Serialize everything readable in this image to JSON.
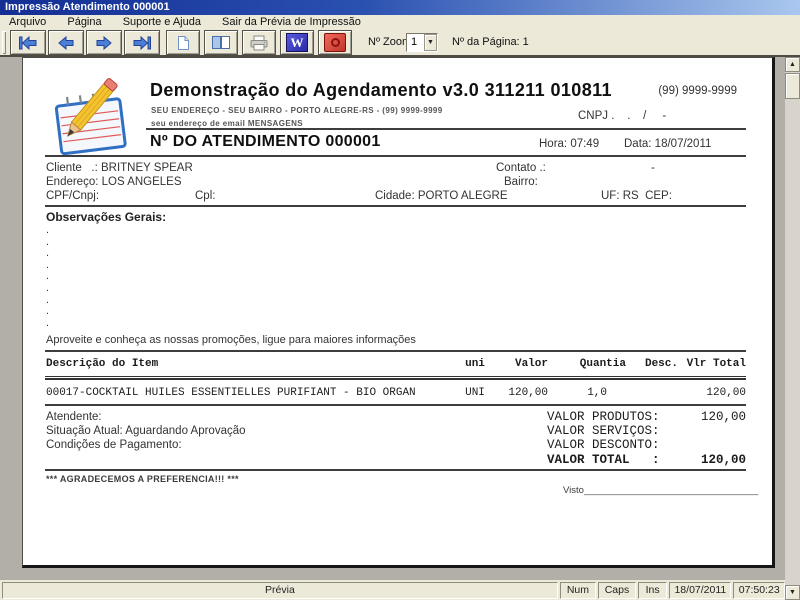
{
  "window": {
    "title": "Impressão Atendimento 000001"
  },
  "menu": {
    "items": [
      "Arquivo",
      "Página",
      "Suporte e Ajuda",
      "Sair da Prévia de Impressão"
    ]
  },
  "toolbar": {
    "zoom_label": "Nº Zoom",
    "zoom_value": "1",
    "page_indicator": "Nº da Página: 1"
  },
  "icons": {
    "word_glyph": "W",
    "up_arrow": "▲",
    "down_arrow": "▼",
    "combo_arrow": "▼"
  },
  "document": {
    "company": {
      "title": "Demonstração do Agendamento v3.0 311211 010811",
      "address": "SEU ENDEREÇO - SEU BAIRRO - PORTO ALEGRE-RS - (99) 9999-9999",
      "email_line": "seu endereço de email  MENSAGENS",
      "phone": "(99) 9999-9999",
      "cnpj": "CNPJ .    .    /     -"
    },
    "order": {
      "number_title": "Nº DO ATENDIMENTO 000001",
      "time": "Hora: 07:49",
      "date": "Data: 18/07/2011"
    },
    "client": {
      "cliente_label": "Cliente   .: ",
      "cliente_value": "BRITNEY SPEAR",
      "contato_label": "Contato .:",
      "contato_value": "-",
      "endereco_label": "Endereço: ",
      "endereco_value": "LOS ANGELES",
      "bairro_label": "Bairro:",
      "cpf_label": "CPF/Cnpj:",
      "cpl_label": "Cpl:",
      "cidade_label": "Cidade: ",
      "cidade_value": "PORTO ALEGRE",
      "uf_cep": "UF: RS  CEP:"
    },
    "observations": {
      "title": "Observações Gerais:",
      "dots": [
        ".",
        ".",
        ".",
        ".",
        ".",
        ".",
        ".",
        ".",
        "."
      ],
      "promo": "Aproveite e conheça as nossas promoções, ligue para maiores informações"
    },
    "items_table": {
      "headers": [
        "Descrição do Item",
        "uni",
        "Valor",
        "Quantia",
        "Desc.",
        "Vlr Total"
      ],
      "rows": [
        {
          "descricao": "00017-COCKTAIL HUILES ESSENTIELLES PURIFIANT - BIO ORGAN",
          "uni": "UNI",
          "valor": "120,00",
          "quantia": "1,0",
          "desc": "",
          "vlr_total": "120,00"
        }
      ]
    },
    "footer": {
      "atendente_label": "Atendente:",
      "situacao_label": "Situação Atual: ",
      "situacao_value": "Aguardando Aprovação",
      "condicoes_label": "Condições de Pagamento:",
      "valor_produtos_label": "VALOR PRODUTOS:",
      "valor_produtos": "120,00",
      "valor_servicos_label": "VALOR SERVIÇOS:",
      "valor_servicos": "",
      "valor_desconto_label": "VALOR DESCONTO:",
      "valor_desconto": "",
      "valor_total_label": "VALOR TOTAL   :",
      "valor_total": "120,00",
      "thanks": "*** AGRADECEMOS A PREFERENCIA!!! ***",
      "visto": "Visto_________________________________"
    }
  },
  "statusbar": {
    "mode": "Prévia",
    "num": "Num",
    "caps": "Caps",
    "ins": "Ins",
    "date": "18/07/2011",
    "time": "07:50:23"
  },
  "colors": {
    "titlebar_start": "#142e94",
    "titlebar_end": "#a9c7ee",
    "chrome": "#ece9d8",
    "workspace": "#b2aea8",
    "nav_arrow": "#4b7fd6",
    "word_icon": "#3a3ac0",
    "close_icon": "#d84438"
  }
}
